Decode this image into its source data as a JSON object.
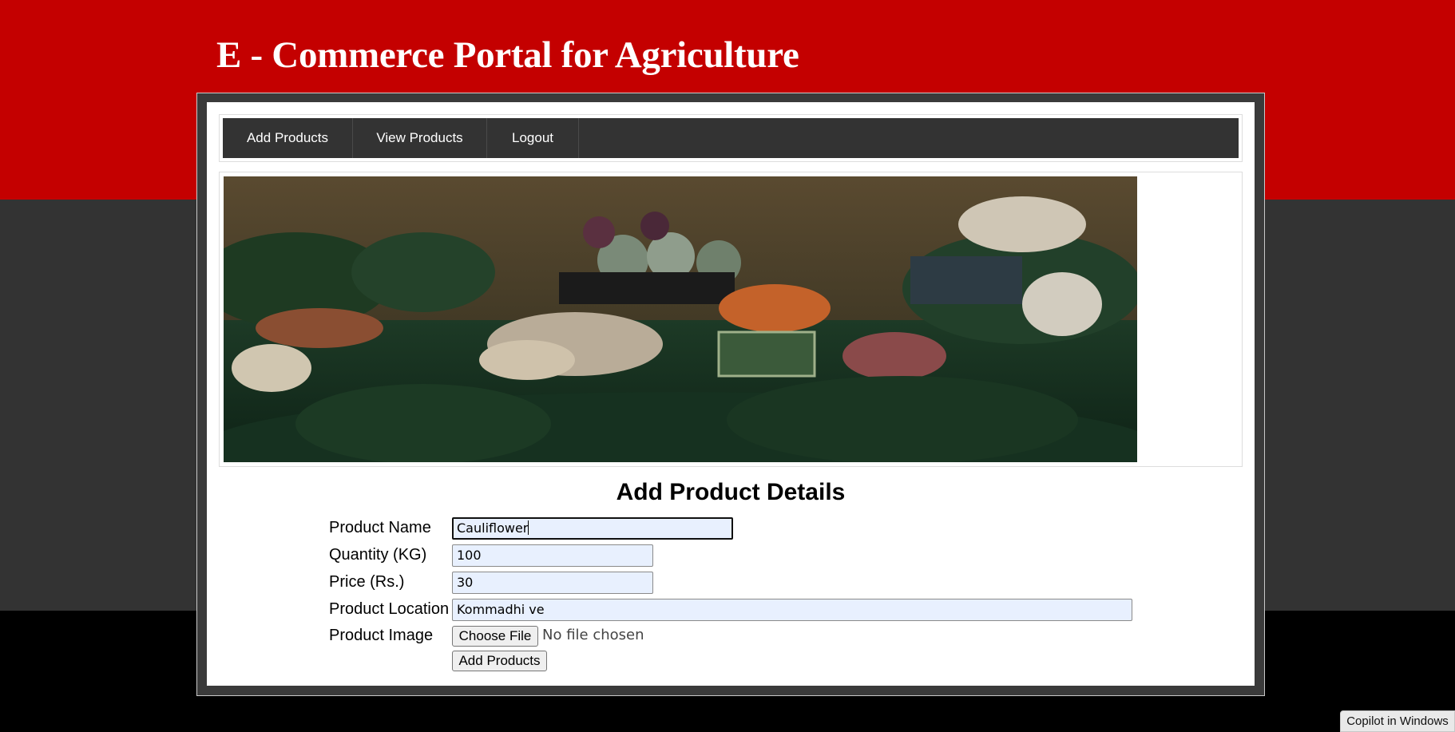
{
  "site": {
    "title": "E - Commerce Portal for Agriculture"
  },
  "nav": {
    "items": [
      {
        "label": "Add Products"
      },
      {
        "label": "View Products"
      },
      {
        "label": "Logout"
      }
    ]
  },
  "banner": {
    "image": "vegetable-market-photo"
  },
  "form": {
    "heading": "Add Product Details",
    "product_name": {
      "label": "Product Name",
      "value": "Cauliflower"
    },
    "quantity": {
      "label": "Quantity (KG)",
      "value": "100"
    },
    "price": {
      "label": "Price (Rs.)",
      "value": "30"
    },
    "location": {
      "label": "Product Location",
      "value": "Kommadhi ve"
    },
    "image": {
      "label": "Product Image",
      "button": "Choose File",
      "status": "No file chosen"
    },
    "submit": "Add Products"
  },
  "taskbar": {
    "copilot": "Copilot in Windows"
  },
  "colors": {
    "header_red": "#c40000",
    "nav_dark": "#333333",
    "page_black": "#000000",
    "input_bg": "#e8f0fe"
  }
}
